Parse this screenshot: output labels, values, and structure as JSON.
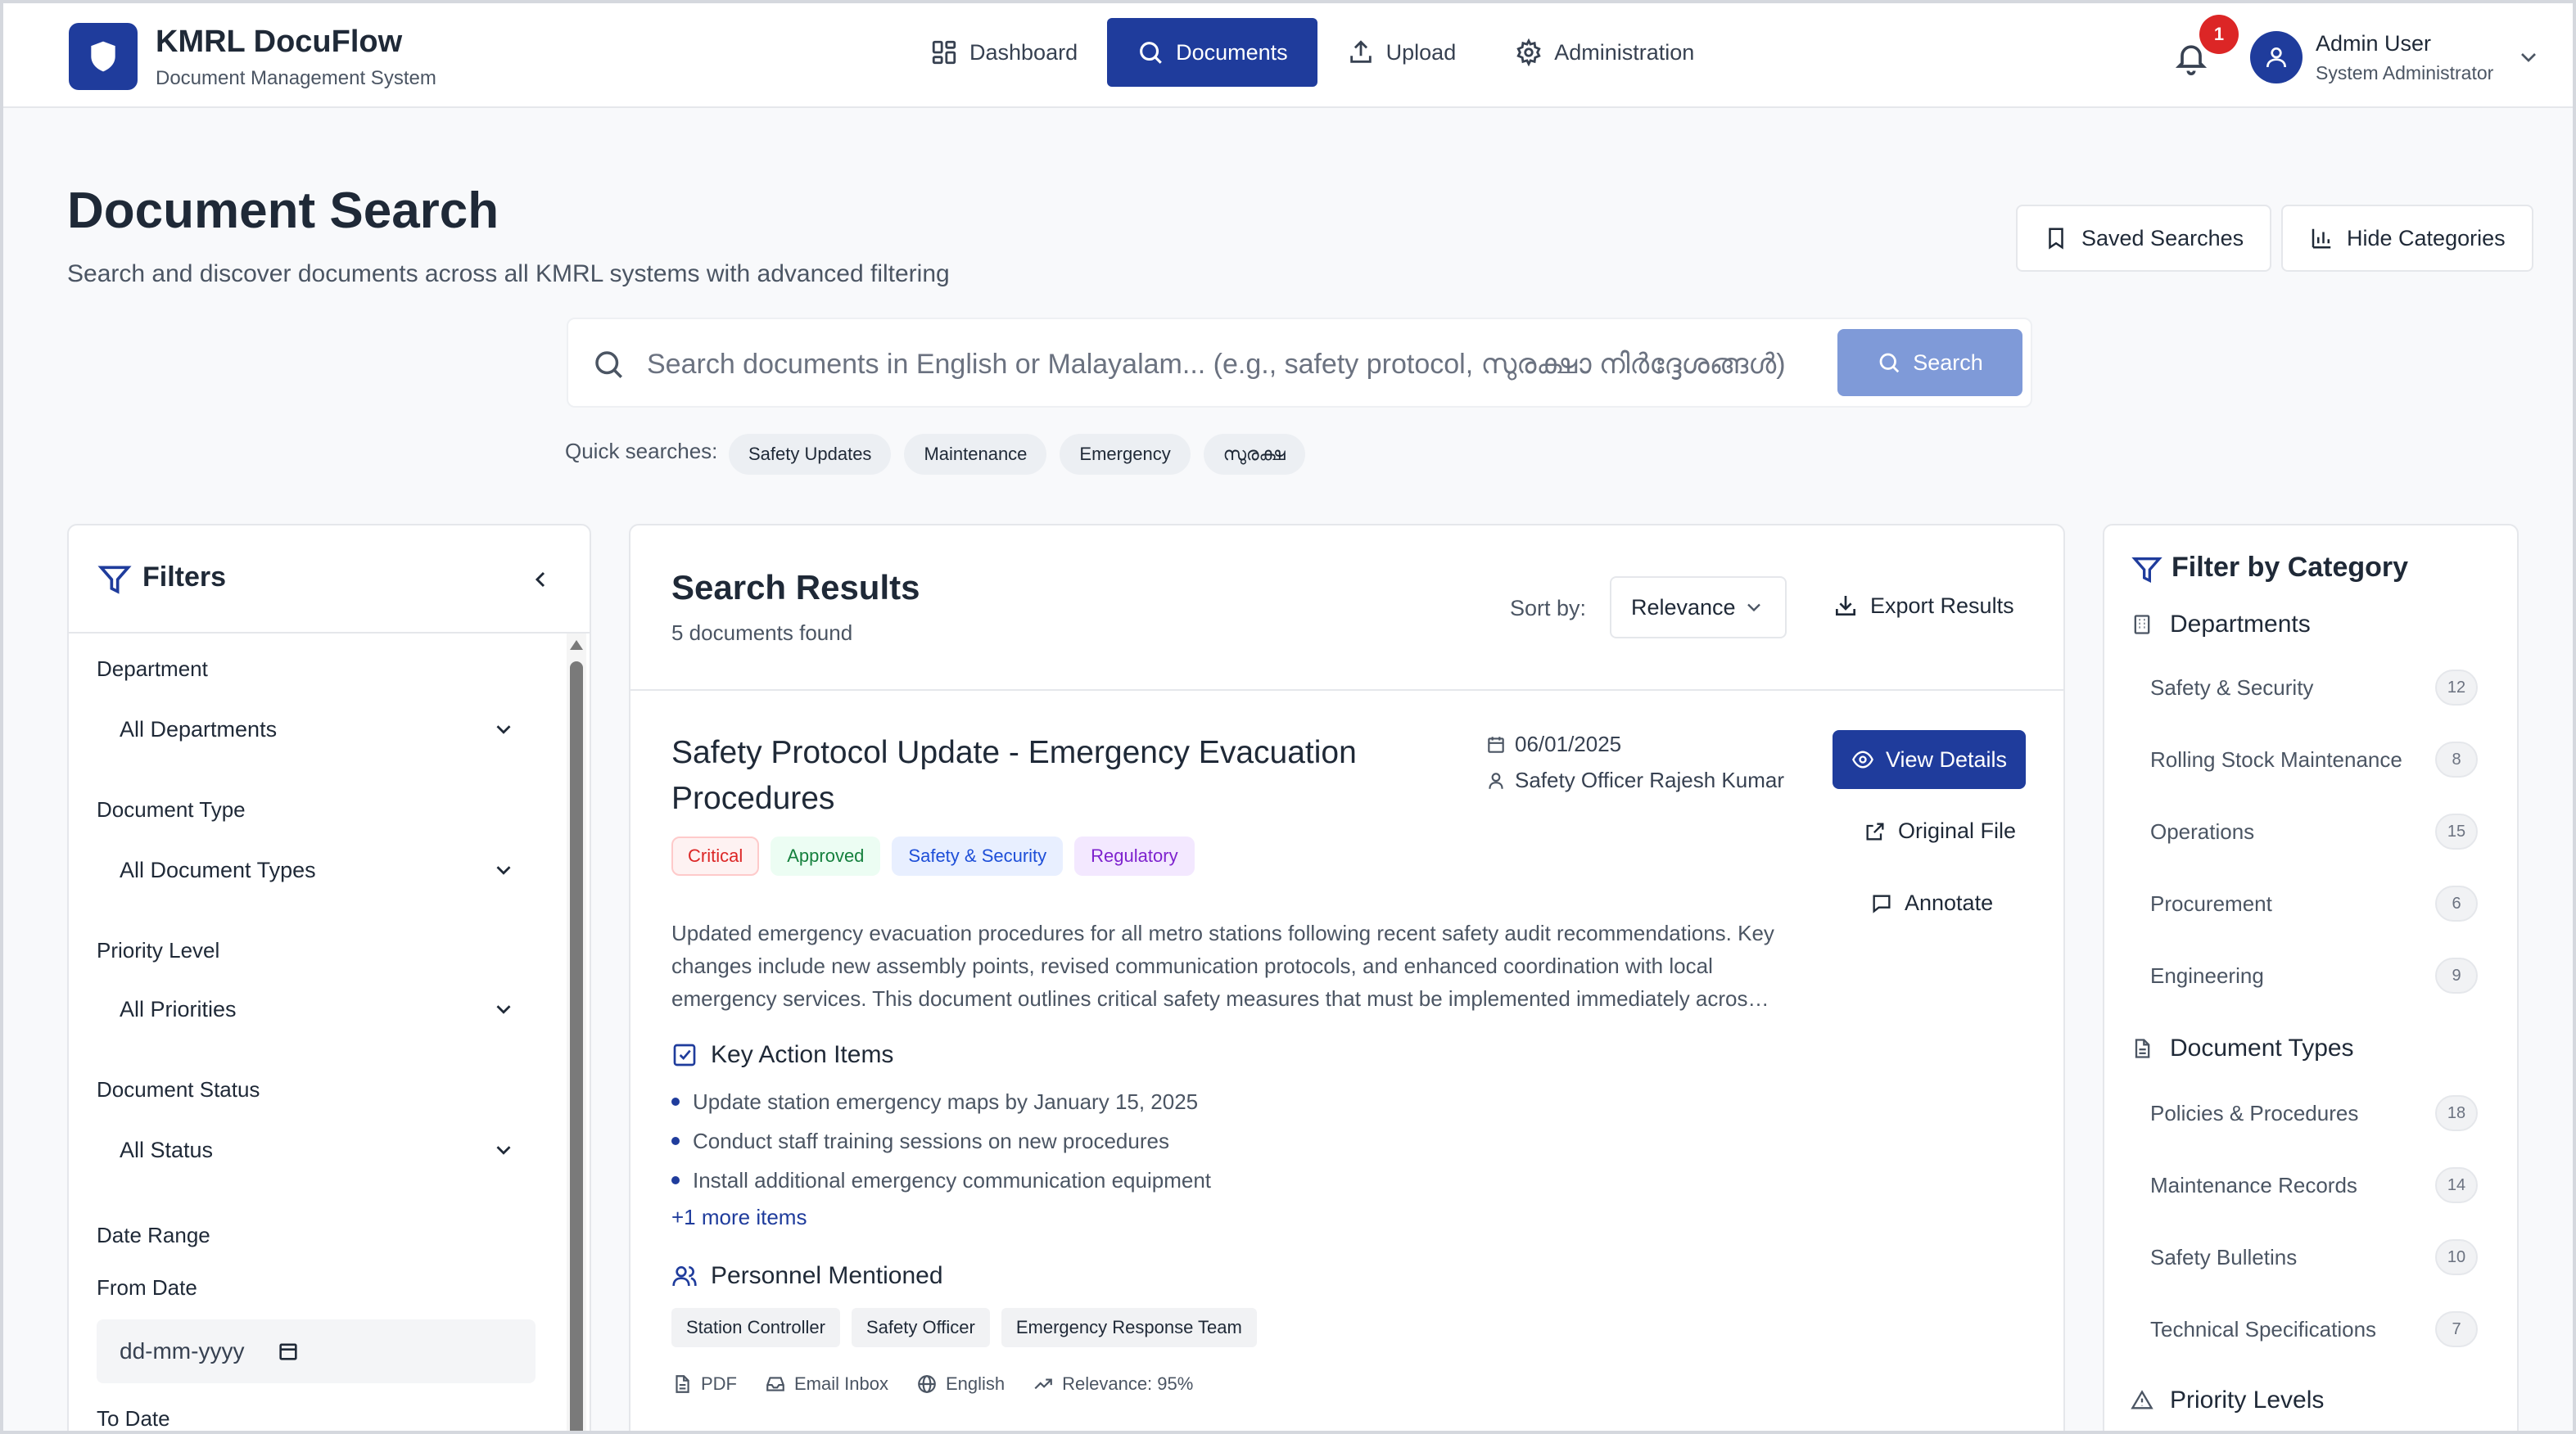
{
  "app": {
    "title": "KMRL DocuFlow",
    "subtitle": "Document Management System"
  },
  "nav": [
    {
      "label": "Dashboard",
      "icon": "dashboard-grid-icon"
    },
    {
      "label": "Documents",
      "icon": "search-icon",
      "active": true
    },
    {
      "label": "Upload",
      "icon": "upload-icon"
    },
    {
      "label": "Administration",
      "icon": "gear-icon"
    }
  ],
  "notifications": {
    "count": "1"
  },
  "user": {
    "name": "Admin User",
    "role": "System Administrator"
  },
  "page": {
    "title": "Document Search",
    "subtitle": "Search and discover documents across all KMRL systems with advanced filtering",
    "saved_searches": "Saved Searches",
    "hide_categories": "Hide Categories"
  },
  "search": {
    "placeholder": "Search documents in English or Malayalam... (e.g., safety protocol, സുരക്ഷാ നിർദ്ദേശങ്ങൾ)",
    "button": "Search",
    "quick_label": "Quick searches:",
    "quick": [
      "Safety Updates",
      "Maintenance",
      "Emergency",
      "സുരക്ഷ"
    ]
  },
  "filters": {
    "title": "Filters",
    "department": {
      "label": "Department",
      "value": "All Departments"
    },
    "doc_type": {
      "label": "Document Type",
      "value": "All Document Types"
    },
    "priority": {
      "label": "Priority Level",
      "value": "All Priorities"
    },
    "status": {
      "label": "Document Status",
      "value": "All Status"
    },
    "date_range": "Date Range",
    "from_date": {
      "label": "From Date",
      "placeholder": "dd-mm-yyyy"
    },
    "to_date": {
      "label": "To Date"
    }
  },
  "results": {
    "title": "Search Results",
    "count": "5 documents found",
    "sort_label": "Sort by:",
    "sort_value": "Relevance",
    "export": "Export Results",
    "doc": {
      "title": "Safety Protocol Update - Emergency Evacuation Procedures",
      "date": "06/01/2025",
      "author": "Safety Officer Rajesh Kumar",
      "tags": [
        "Critical",
        "Approved",
        "Safety & Security",
        "Regulatory"
      ],
      "view_details": "View Details",
      "original_file": "Original File",
      "annotate": "Annotate",
      "summary": "Updated emergency evacuation procedures for all metro stations following recent safety audit recommendations. Key changes include new assembly points, revised communication protocols, and enhanced coordination with local emergency services. This document outlines critical safety measures that must be implemented immediately acros…",
      "key_actions_title": "Key Action Items",
      "key_actions": [
        "Update station emergency maps by January 15, 2025",
        "Conduct staff training sessions on new procedures",
        "Install additional emergency communication equipment"
      ],
      "more_items": "+1 more items",
      "personnel_title": "Personnel Mentioned",
      "personnel": [
        "Station Controller",
        "Safety Officer",
        "Emergency Response Team"
      ],
      "meta": {
        "format": "PDF",
        "source": "Email Inbox",
        "language": "English",
        "relevance": "Relevance: 95%"
      }
    }
  },
  "categories": {
    "title": "Filter by Category",
    "departments_title": "Departments",
    "departments": [
      {
        "name": "Safety & Security",
        "count": "12"
      },
      {
        "name": "Rolling Stock Maintenance",
        "count": "8"
      },
      {
        "name": "Operations",
        "count": "15"
      },
      {
        "name": "Procurement",
        "count": "6"
      },
      {
        "name": "Engineering",
        "count": "9"
      }
    ],
    "doc_types_title": "Document Types",
    "doc_types": [
      {
        "name": "Policies & Procedures",
        "count": "18"
      },
      {
        "name": "Maintenance Records",
        "count": "14"
      },
      {
        "name": "Safety Bulletins",
        "count": "10"
      },
      {
        "name": "Technical Specifications",
        "count": "7"
      }
    ],
    "priority_title": "Priority Levels"
  },
  "colors": {
    "brand": "#1f3c9c",
    "search_button": "#7f9ad8",
    "badge": "#dc2626"
  }
}
